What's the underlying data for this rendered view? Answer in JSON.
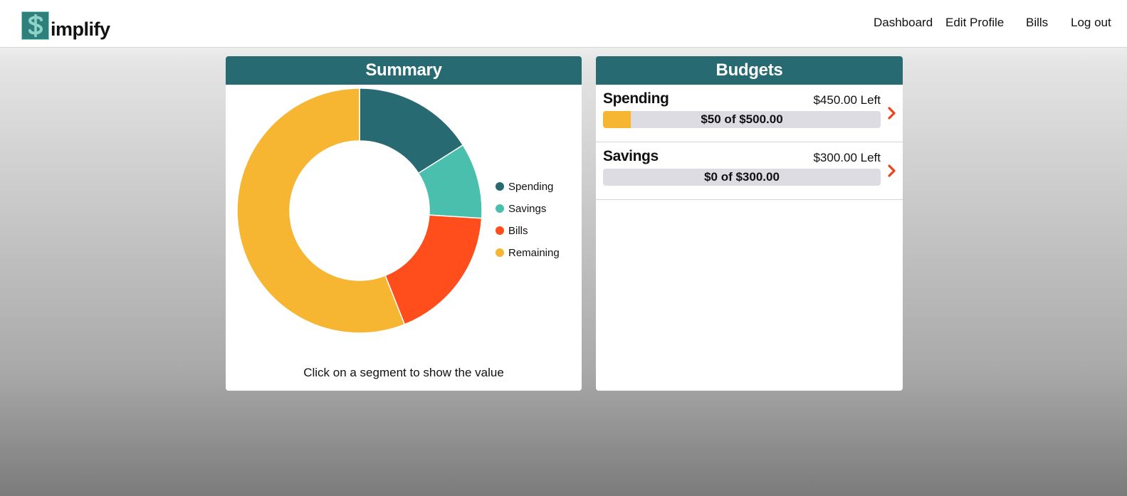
{
  "app": {
    "logo_text": "implify",
    "logo_glyph": "$"
  },
  "nav": {
    "items": [
      {
        "label": "Dashboard"
      },
      {
        "label": "Edit Profile"
      },
      {
        "label": "Bills"
      },
      {
        "label": "Log out"
      }
    ]
  },
  "summary": {
    "title": "Summary",
    "caption": "Click on a segment to show the value"
  },
  "budgets": {
    "title": "Budgets",
    "items": [
      {
        "name": "Spending",
        "left_text": "$450.00 Left",
        "progress_text": "$50 of $500.00",
        "progress_fraction": 0.1
      },
      {
        "name": "Savings",
        "left_text": "$300.00 Left",
        "progress_text": "$0 of $300.00",
        "progress_fraction": 0.0
      }
    ]
  },
  "colors": {
    "primary": "#276a72",
    "spending": "#276a72",
    "savings": "#4bbfae",
    "bills": "#ff4d1c",
    "remaining": "#f6b632",
    "progress_track": "#dcdce2",
    "progress_fill": "#f6b632",
    "chevron": "#f0421a"
  },
  "chart_data": {
    "type": "pie",
    "donut": true,
    "legend_placement": "right",
    "categories": [
      "Spending",
      "Savings",
      "Bills",
      "Remaining"
    ],
    "values": [
      16,
      10,
      18,
      56
    ],
    "colors": [
      "#276a72",
      "#4bbfae",
      "#ff4d1c",
      "#f6b632"
    ]
  }
}
